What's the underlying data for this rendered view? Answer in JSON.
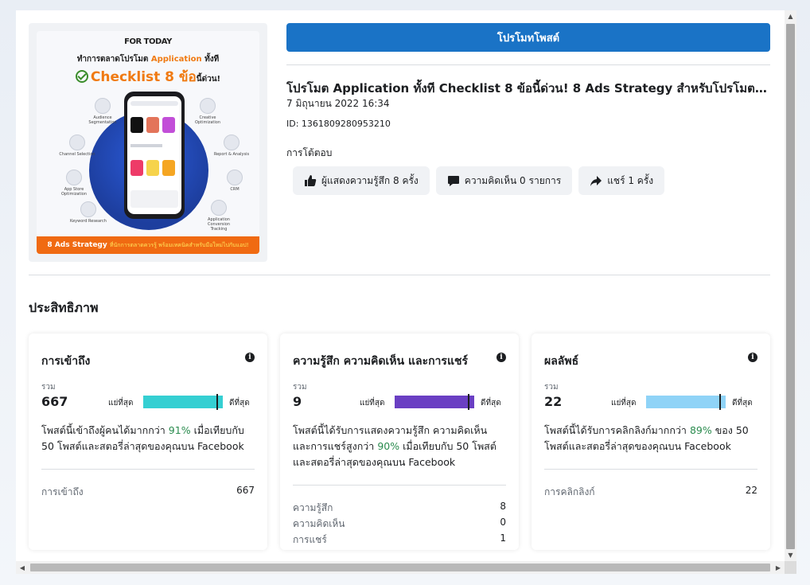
{
  "promote_button": "โปรโมทโพสต์",
  "post": {
    "title": "โปรโมต Application ทั้งที Checklist 8 ข้อนี้ด่วน! 8 Ads Strategy สำหรับโปรโมตแ...",
    "date": "7 มิถุนายน 2022 16:34",
    "id": "ID: 1361809280953210"
  },
  "post_image": {
    "brand": "FOR TODAY",
    "line1_prefix": "ทำการตลาดโปรโมต",
    "line1_highlight": "Application",
    "line1_suffix": "ทั้งที",
    "line2": "Checklist 8 ข้อ",
    "line2_suffix": "นี้ด่วน!",
    "features": [
      "Audience Segmentation",
      "Creative Optimization",
      "Channel Selection",
      "Report & Analysis",
      "App Store Optimization",
      "CRM",
      "Keyword Research",
      "Application Conversion Tracking"
    ],
    "banner_main": "8 Ads Strategy",
    "banner_sub": "ที่นักการตลาดควรรู้ พร้อมเทคนิคสำหรับมือใหม่ไปกับแอป!"
  },
  "engagement": {
    "label": "การโต้ตอบ",
    "likes": "ผู้แสดงความรู้สึก 8 ครั้ง",
    "comments": "ความคิดเห็น 0 รายการ",
    "shares": "แชร์ 1 ครั้ง"
  },
  "performance_title": "ประสิทธิภาพ",
  "cards": [
    {
      "title": "การเข้าถึง",
      "total_label": "รวม",
      "total": "667",
      "worst": "แย่ที่สุด",
      "best": "ดีที่สุด",
      "percentile": 0.93,
      "bar_color": "#35cfd2",
      "desc_prefix": "โพสต์นี้เข้าถึงผู้คนได้มากกว่า ",
      "desc_pct": "91%",
      "desc_suffix": " เมื่อเทียบกับ 50 โพสต์และสตอรี่ล่าสุดของคุณบน Facebook",
      "metrics": [
        {
          "label": "การเข้าถึง",
          "value": "667"
        }
      ]
    },
    {
      "title": "ความรู้สึก ความคิดเห็น และการแชร์",
      "total_label": "รวม",
      "total": "9",
      "worst": "แย่ที่สุด",
      "best": "ดีที่สุด",
      "percentile": 0.93,
      "bar_color": "#6a3fc3",
      "desc_prefix": "โพสต์นี้ได้รับการแสดงความรู้สึก ความคิดเห็น และการแชร์สูงกว่า ",
      "desc_pct": "90%",
      "desc_suffix": " เมื่อเทียบกับ 50 โพสต์และสตอรี่ล่าสุดของคุณบน Facebook",
      "metrics": [
        {
          "label": "ความรู้สึก",
          "value": "8"
        },
        {
          "label": "ความคิดเห็น",
          "value": "0"
        },
        {
          "label": "การแชร์",
          "value": "1"
        }
      ]
    },
    {
      "title": "ผลลัพธ์",
      "total_label": "รวม",
      "total": "22",
      "worst": "แย่ที่สุด",
      "best": "ดีที่สุด",
      "percentile": 0.93,
      "bar_color": "#8fd3f7",
      "desc_prefix": "โพสต์นี้ได้รับการคลิกลิงก์มากกว่า ",
      "desc_pct": "89%",
      "desc_suffix": " ของ 50 โพสต์และสตอรี่ล่าสุดของคุณบน Facebook",
      "metrics": [
        {
          "label": "การคลิกลิงก์",
          "value": "22"
        }
      ]
    }
  ]
}
